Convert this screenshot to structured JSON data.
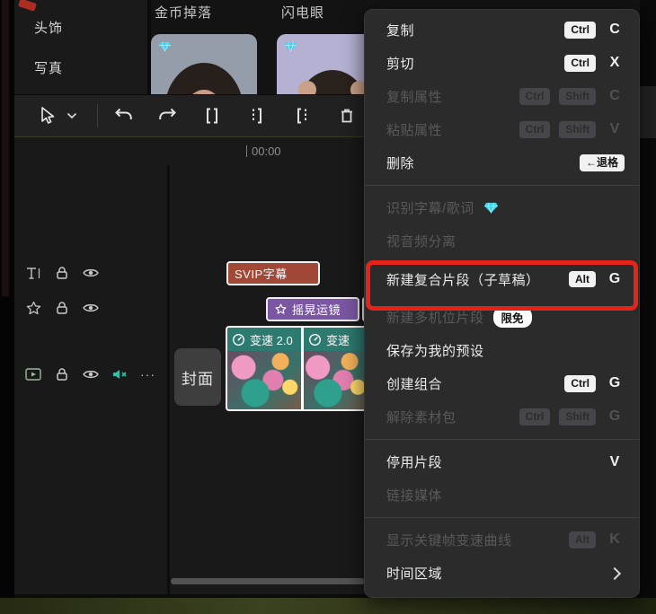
{
  "sidebar": {
    "items": [
      {
        "label": "头饰"
      },
      {
        "label": "写真"
      }
    ]
  },
  "effects": {
    "items": [
      {
        "label": "金币掉落",
        "vip": true
      },
      {
        "label": "闪电眼",
        "vip": true
      }
    ]
  },
  "toolbar": {
    "icons": [
      "cursor",
      "chevron-down",
      "undo",
      "redo",
      "split",
      "split-keep-left",
      "split-keep-right",
      "delete"
    ]
  },
  "ruler": {
    "time": "00:00"
  },
  "track_headers": {
    "text_track": [
      "text-icon",
      "lock-icon",
      "eye-icon"
    ],
    "effect_track": [
      "star-icon",
      "lock-icon",
      "eye-icon"
    ],
    "video_track": [
      "video-icon",
      "lock-icon",
      "eye-icon",
      "mute-icon",
      "more"
    ],
    "more_label": "···"
  },
  "timeline": {
    "cover_button": "封面",
    "subtitle_clip": "SVIP字幕",
    "effect_clip": "摇晃运镜",
    "video_clips": [
      {
        "speed_label": "变速 2.0"
      },
      {
        "speed_label": "变速"
      }
    ]
  },
  "colors": {
    "accent_red": "#e3241b",
    "diamond_cyan": "#45d0ee",
    "teal_bar": "#2d7a70",
    "purple_clip": "#7b57a3",
    "subtitle_red": "#a14836"
  },
  "menu": {
    "items": [
      {
        "label": "复制",
        "badge1": "Ctrl",
        "key": "C",
        "disabled": false
      },
      {
        "label": "剪切",
        "badge1": "Ctrl",
        "key": "X",
        "disabled": false
      },
      {
        "label": "复制属性",
        "badge1": "Ctrl",
        "badge2": "Shift",
        "key": "C",
        "disabled": true
      },
      {
        "label": "粘贴属性",
        "badge1": "Ctrl",
        "badge2": "Shift",
        "key": "V",
        "disabled": true
      },
      {
        "label": "删除",
        "badge1": "←退格",
        "disabled": false
      },
      {
        "label": "识别字幕/歌词",
        "disabled": true,
        "icon": "diamond"
      },
      {
        "label": "视音频分离",
        "disabled": true
      },
      {
        "label": "新建复合片段（子草稿）",
        "badge1": "Alt",
        "key": "G",
        "disabled": false,
        "highlighted": true
      },
      {
        "label": "新建多机位片段",
        "pill": "限免",
        "disabled": true
      },
      {
        "label": "保存为我的预设",
        "disabled": false
      },
      {
        "label": "创建组合",
        "badge1": "Ctrl",
        "key": "G",
        "disabled": false
      },
      {
        "label": "解除素材包",
        "badge1": "Ctrl",
        "badge2": "Shift",
        "key": "G",
        "disabled": true
      },
      {
        "label": "停用片段",
        "key": "V",
        "disabled": false
      },
      {
        "label": "链接媒体",
        "disabled": true
      },
      {
        "label": "显示关键帧变速曲线",
        "badge1": "Alt",
        "key": "K",
        "disabled": true
      },
      {
        "label": "时间区域",
        "submenu": true,
        "disabled": false
      }
    ]
  }
}
